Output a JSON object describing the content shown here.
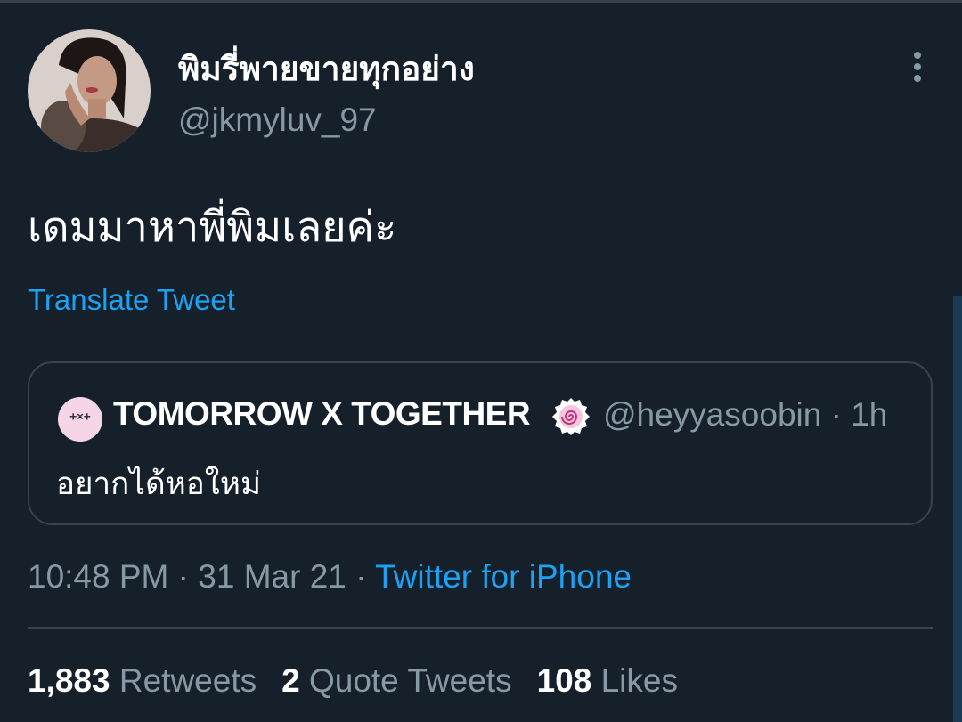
{
  "tweet": {
    "display_name": "พิมรี่พายขายทุกอย่าง",
    "handle": "@jkmyluv_97",
    "text": "เดมมาหาพี่พิมเลยค่ะ",
    "translate_label": "Translate Tweet",
    "time": "10:48 PM",
    "date": "31 Mar 21",
    "source": "Twitter for iPhone",
    "separator": " · "
  },
  "quote": {
    "avatar_text": "+×+",
    "name": "TOMORROW X TOGETHER",
    "handle": "@heyyasoobin",
    "age": "1h",
    "separator": " · ",
    "text": "อยากได้หอใหม่"
  },
  "stats": [
    {
      "count": "1,883",
      "label": "Retweets"
    },
    {
      "count": "2",
      "label": "Quote Tweets"
    },
    {
      "count": "108",
      "label": "Likes"
    }
  ],
  "colors": {
    "background": "#15202b",
    "accent": "#1da1f2",
    "muted": "#8899a6",
    "border": "#38444d"
  },
  "icons": {
    "more": "more-vertical-icon",
    "verified": "swirl-badge-icon"
  }
}
